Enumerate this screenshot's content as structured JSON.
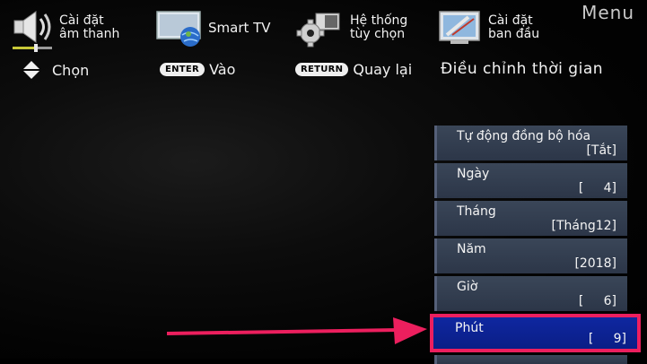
{
  "header": {
    "menu_title": "Menu",
    "tabs": [
      {
        "label": "Cài đặt\nâm thanh",
        "icon": "speaker-icon"
      },
      {
        "label": "Smart TV",
        "icon": "smart-tv-icon"
      },
      {
        "label": "Hệ thống\ntùy chọn",
        "icon": "system-options-icon"
      },
      {
        "label": "Cài đặt\nban đầu",
        "icon": "initial-setup-icon"
      }
    ]
  },
  "hints": {
    "select": "Chọn",
    "enter_key": "ENTER",
    "enter": "Vào",
    "return_key": "RETURN",
    "back": "Quay lại"
  },
  "page": {
    "title": "Điều chỉnh thời gian"
  },
  "settings": [
    {
      "name": "Tự động đồng bộ hóa",
      "value": "[Tắt]"
    },
    {
      "name": "Ngày",
      "value": "[     4]"
    },
    {
      "name": "Tháng",
      "value": "[Tháng12]"
    },
    {
      "name": "Năm",
      "value": "[2018]"
    },
    {
      "name": "Giờ",
      "value": "[     6]"
    },
    {
      "name": "Phút",
      "value": "[     9]"
    }
  ],
  "colors": {
    "highlight_border": "#ec1f5e",
    "selected_bg": "#0f27a0",
    "item_bg": "#34405a",
    "arrow": "#ec1f5e"
  }
}
